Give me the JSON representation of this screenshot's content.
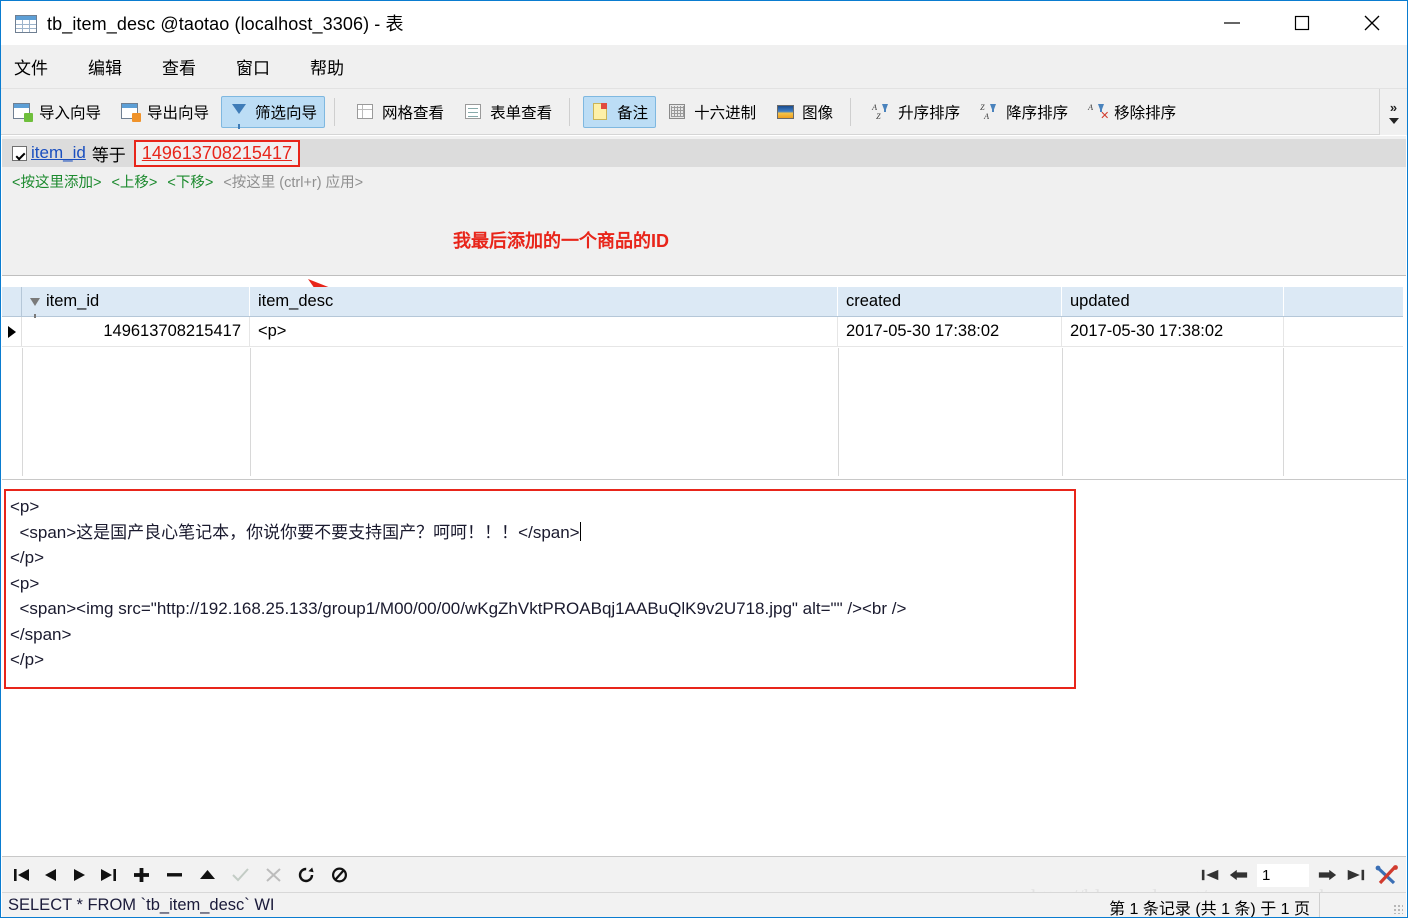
{
  "window": {
    "title": "tb_item_desc @taotao (localhost_3306) - 表",
    "icon": "table-icon",
    "controls": {
      "minimize": "minimize-icon",
      "maximize": "maximize-icon",
      "close": "close-icon"
    }
  },
  "menu": {
    "items": [
      {
        "label": "文件"
      },
      {
        "label": "编辑"
      },
      {
        "label": "查看"
      },
      {
        "label": "窗口"
      },
      {
        "label": "帮助"
      }
    ]
  },
  "toolbar": {
    "buttons": [
      {
        "label": "导入向导",
        "icon": "import-wizard-icon",
        "active": false
      },
      {
        "label": "导出向导",
        "icon": "export-wizard-icon",
        "active": false
      },
      {
        "label": "筛选向导",
        "icon": "filter-wizard-icon",
        "active": true
      },
      {
        "label": "网格查看",
        "icon": "grid-view-icon",
        "active": false
      },
      {
        "label": "表单查看",
        "icon": "form-view-icon",
        "active": false
      },
      {
        "label": "备注",
        "icon": "memo-icon",
        "active": true
      },
      {
        "label": "十六进制",
        "icon": "hex-icon",
        "active": false
      },
      {
        "label": "图像",
        "icon": "image-icon",
        "active": false
      },
      {
        "label": "升序排序",
        "icon": "sort-ascending-icon",
        "active": false
      },
      {
        "label": "降序排序",
        "icon": "sort-descending-icon",
        "active": false
      },
      {
        "label": "移除排序",
        "icon": "remove-sort-icon",
        "active": false
      }
    ],
    "overflow": "»"
  },
  "filter": {
    "checked": true,
    "field": "item_id",
    "operator": "等于",
    "value": "149613708215417",
    "value_highlight_color": "#e8251a",
    "actions": [
      {
        "label": "<按这里添加>",
        "color": "#1c8a2e"
      },
      {
        "label": "<上移>",
        "color": "#1c8a2e"
      },
      {
        "label": "<下移>",
        "color": "#1c8a2e"
      },
      {
        "label": "<按这里 (ctrl+r) 应用>",
        "color": "#8f8f8f"
      }
    ]
  },
  "annotation": {
    "text": "我最后添加的一个商品的ID",
    "color": "#e8251a"
  },
  "grid": {
    "columns": [
      {
        "label": "item_id",
        "filtered": true
      },
      {
        "label": "item_desc",
        "filtered": false
      },
      {
        "label": "created",
        "filtered": false
      },
      {
        "label": "updated",
        "filtered": false
      }
    ],
    "rows": [
      {
        "selected": true,
        "item_id": "149613708215417",
        "item_desc": "<p>",
        "created": "2017-05-30 17:38:02",
        "updated": "2017-05-30 17:38:02"
      }
    ]
  },
  "memo": {
    "content": "<p>\n  <span>这是国产良心笔记本，你说你要不要支持国产？呵呵！！！</span>",
    "content_rest": "</p>\n<p>\n  <span><img src=\"http://192.168.25.133/group1/M00/00/00/wKgZhVktPROABqj1AABuQlK9v2U718.jpg\" alt=\"\" /><br />\n</span>\n</p>"
  },
  "navbar": {
    "buttons": [
      {
        "name": "first-record",
        "icon": "first-icon",
        "enabled": true
      },
      {
        "name": "previous-record",
        "icon": "previous-icon",
        "enabled": true
      },
      {
        "name": "next-record",
        "icon": "next-icon",
        "enabled": true
      },
      {
        "name": "last-record",
        "icon": "last-icon",
        "enabled": true
      },
      {
        "name": "add-record",
        "icon": "plus-icon",
        "enabled": true
      },
      {
        "name": "delete-record",
        "icon": "minus-icon",
        "enabled": true
      },
      {
        "name": "apply-change",
        "icon": "triangle-up-icon",
        "enabled": true
      },
      {
        "name": "confirm-edit",
        "icon": "check-icon",
        "enabled": false
      },
      {
        "name": "cancel-edit",
        "icon": "cancel-icon",
        "enabled": false
      },
      {
        "name": "refresh",
        "icon": "refresh-icon",
        "enabled": true
      },
      {
        "name": "stop",
        "icon": "stop-icon",
        "enabled": true
      }
    ],
    "page_value": "1"
  },
  "status": {
    "sql": "SELECT * FROM `tb_item_desc` WI",
    "records": "第 1 条记录 (共 1 条) 于 1 页",
    "watermark": "http://blog.csdn.net/zerenyuan_pku"
  }
}
